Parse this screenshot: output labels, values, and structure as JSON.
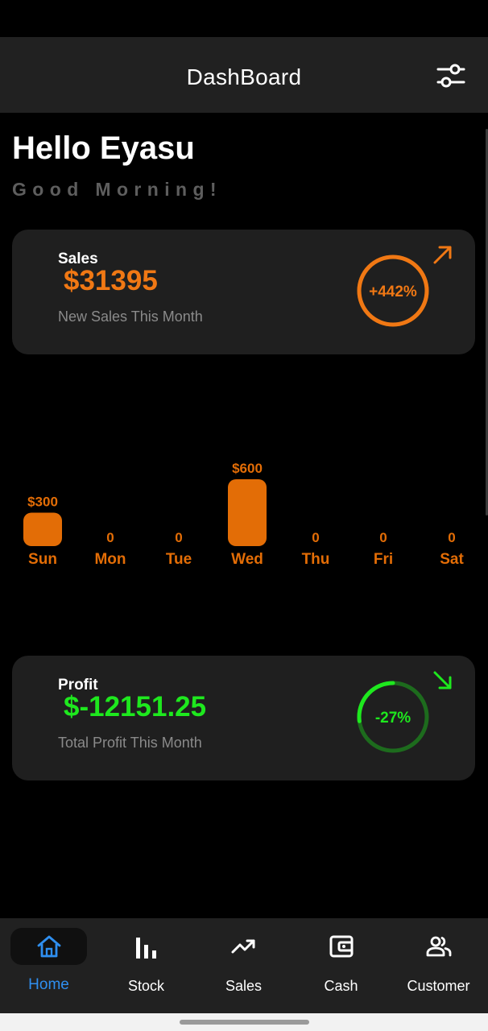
{
  "app_bar": {
    "title": "DashBoard",
    "filter_icon": "tune-icon"
  },
  "greeting": {
    "title": "Hello Eyasu",
    "subtitle": "Good Morning!"
  },
  "sales_card": {
    "label": "Sales",
    "value": "$31395",
    "caption": "New Sales This Month",
    "percent": "+442%",
    "ring_fill": 1.0,
    "trend_icon": "arrow-up-right-icon",
    "color": "#f07814"
  },
  "weekly_chart": {
    "chart_data": {
      "type": "bar",
      "categories": [
        "Sun",
        "Mon",
        "Tue",
        "Wed",
        "Thu",
        "Fri",
        "Sat"
      ],
      "values": [
        300,
        0,
        0,
        600,
        0,
        0,
        0
      ],
      "value_labels": [
        "$300",
        "0",
        "0",
        "$600",
        "0",
        "0",
        "0"
      ],
      "title": "",
      "xlabel": "",
      "ylabel": "",
      "ylim": [
        0,
        600
      ]
    },
    "color": "#e36d06"
  },
  "profit_card": {
    "label": "Profit",
    "value": "$-12151.25",
    "caption": "Total Profit This Month",
    "percent": "-27%",
    "ring_fill": 0.27,
    "trend_icon": "arrow-down-right-icon",
    "color": "#1ee81e"
  },
  "bottom_nav": [
    {
      "label": "Home",
      "icon": "home-icon",
      "active": true
    },
    {
      "label": "Stock",
      "icon": "bar-chart-icon",
      "active": false
    },
    {
      "label": "Sales",
      "icon": "trending-up-icon",
      "active": false
    },
    {
      "label": "Cash",
      "icon": "wallet-icon",
      "active": false
    },
    {
      "label": "Customer",
      "icon": "people-icon",
      "active": false
    }
  ],
  "colors": {
    "active_nav": "#2f8ff0",
    "card_bg": "#1f1f1f",
    "app_bar": "#212121"
  }
}
